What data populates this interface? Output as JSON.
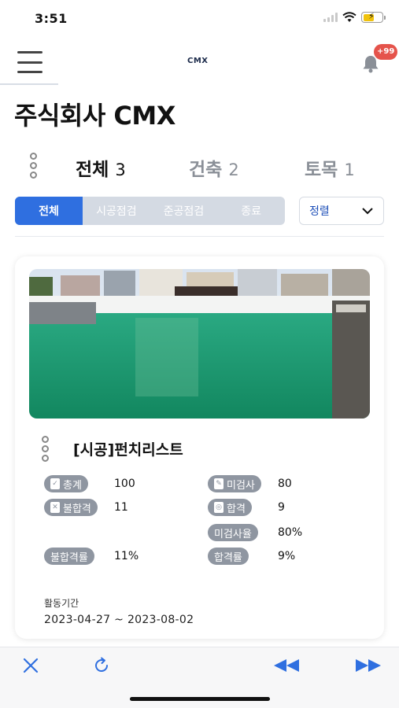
{
  "status_bar": {
    "time": "3:51"
  },
  "header": {
    "logo": "CMX",
    "notification_badge": "+99"
  },
  "company": {
    "name": "주식회사 CMX"
  },
  "category_tabs": [
    {
      "label": "전체",
      "count": "3",
      "active": true
    },
    {
      "label": "건축",
      "count": "2",
      "active": false
    },
    {
      "label": "토목",
      "count": "1",
      "active": false
    }
  ],
  "filters": [
    {
      "label": "전체",
      "active": true
    },
    {
      "label": "시공점검",
      "active": false
    },
    {
      "label": "준공점검",
      "active": false
    },
    {
      "label": "종료",
      "active": false
    }
  ],
  "sort": {
    "label": "정렬"
  },
  "card": {
    "title": "[시공]펀치리스트",
    "stats": {
      "total": {
        "label": "총계",
        "value": "100"
      },
      "uninspected": {
        "label": "미검사",
        "value": "80"
      },
      "fail": {
        "label": "불합격",
        "value": "11"
      },
      "pass": {
        "label": "합격",
        "value": "9"
      },
      "uninspected_rate": {
        "label": "미검사율",
        "value": "80%"
      },
      "fail_rate": {
        "label": "불합격률",
        "value": "11%"
      },
      "pass_rate": {
        "label": "합격률",
        "value": "9%"
      }
    },
    "period_label": "활동기간",
    "period_start": "2023-04-27",
    "period_sep": "~",
    "period_end": "2023-08-02"
  },
  "colors": {
    "primary": "#2f6fe0",
    "chip": "#8f96a1",
    "badge": "#e5534b",
    "pool": "#1f9a74"
  }
}
